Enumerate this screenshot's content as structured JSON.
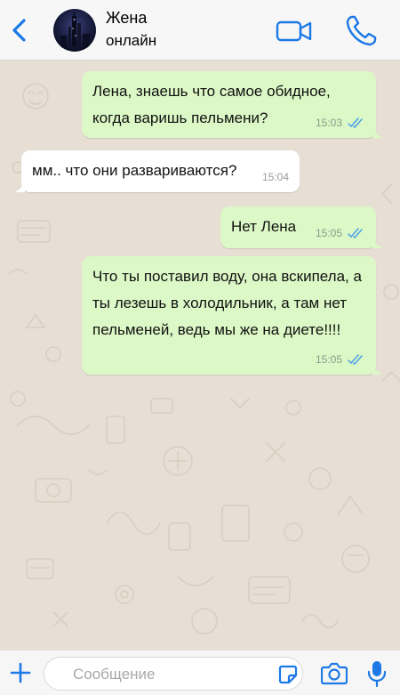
{
  "colors": {
    "accent": "#1c79e6",
    "outgoing_bubble": "#dcf8c6",
    "incoming_bubble": "#ffffff",
    "read_ticks": "#4aa1e8",
    "wallpaper": "#e7dfd4"
  },
  "header": {
    "back_icon": "chevron-left-icon",
    "contact_name": "Жена",
    "contact_status": "онлайн",
    "video_icon": "video-camera-icon",
    "call_icon": "phone-icon"
  },
  "messages": [
    {
      "direction": "outgoing",
      "text": "Лена, знаешь что самое обидное, когда варишь пельмени?",
      "time": "15:03",
      "read": true
    },
    {
      "direction": "incoming",
      "text": "мм.. что они развариваются?",
      "time": "15:04"
    },
    {
      "direction": "outgoing",
      "text": "Нет Лена",
      "time": "15:05",
      "read": true
    },
    {
      "direction": "outgoing",
      "text": "Что ты поставил воду, она вскипела, а ты лезешь в холодильник, а там нет пельменей, ведь мы же на диете!!!!",
      "time": "15:05",
      "read": true
    }
  ],
  "composer": {
    "attach_icon": "plus-icon",
    "placeholder": "Сообщение",
    "value": "",
    "sticker_icon": "sticker-icon",
    "camera_icon": "camera-icon",
    "mic_icon": "microphone-icon"
  }
}
